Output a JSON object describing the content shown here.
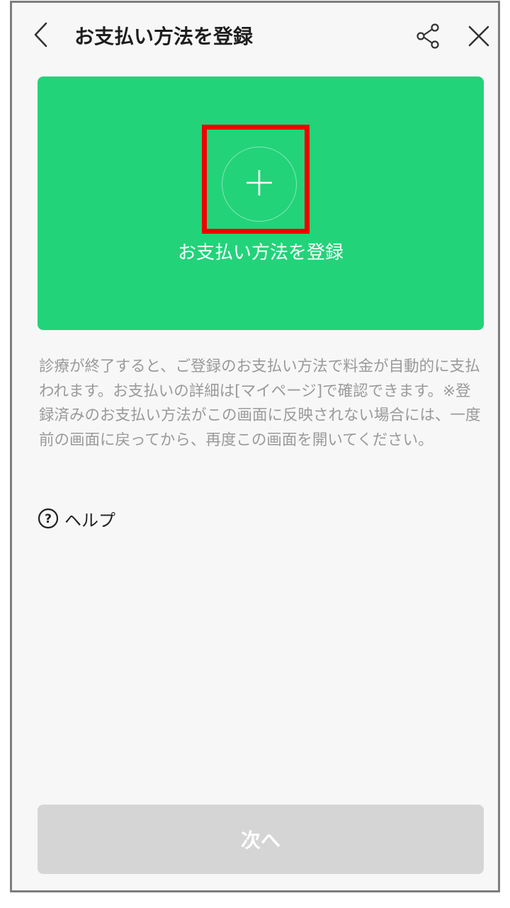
{
  "header": {
    "title": "お支払い方法を登録",
    "back_icon": "chevron-left-icon",
    "share_icon": "share-icon",
    "close_icon": "close-icon"
  },
  "register_card": {
    "label": "お支払い方法を登録",
    "icon": "plus-icon",
    "background_color": "#22d37a",
    "highlight_color": "#ee0000"
  },
  "description": "診療が終了すると、ご登録のお支払い方法で料金が自動的に支払われます。お支払いの詳細は[マイページ]で確認できます。※登録済みのお支払い方法がこの画面に反映されない場合には、一度前の画面に戻ってから、再度この画面を開いてください。",
  "help": {
    "label": "ヘルプ",
    "icon": "question-circle-icon"
  },
  "next_button": {
    "label": "次へ",
    "state": "disabled"
  }
}
